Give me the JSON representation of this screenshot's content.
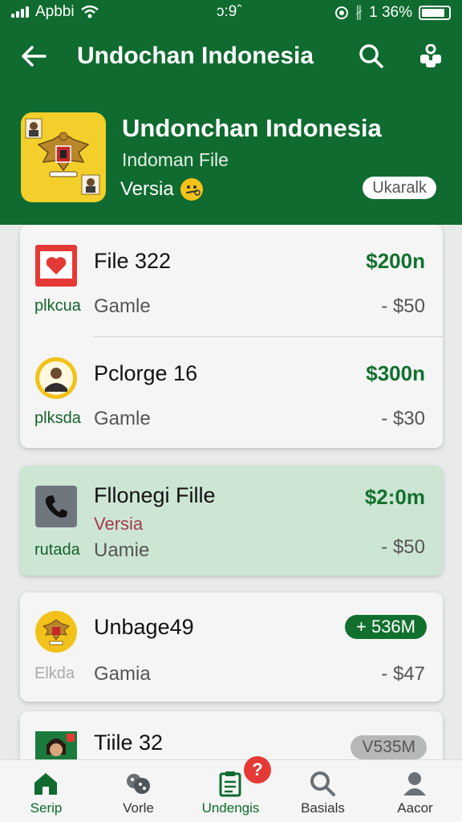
{
  "status_bar": {
    "carrier": "Apbbi",
    "time": "ɔ:9ˆ",
    "bluetooth": "∦",
    "battery_text": "1 36%"
  },
  "toolbar": {
    "title": "Undochan Indonesia",
    "back_icon": "arrow-left-icon",
    "search_icon": "search-icon",
    "menu_icon": "apps-icon"
  },
  "app_info": {
    "name": "Undonchan Indonesia",
    "subtitle": "Indoman File",
    "version_label": "Versia",
    "action_label": "Ukaralk"
  },
  "list_card_1": [
    {
      "name": "File 322",
      "price": "$200n",
      "tag": "plkcua",
      "type": "Gamle",
      "sub_price": "-  $50",
      "icon": "heart-image-icon"
    },
    {
      "name": "Pclorge 16",
      "price": "$300n",
      "tag": "plksda",
      "type": "Gamle",
      "sub_price": "-  $30",
      "icon": "person-avatar-icon"
    }
  ],
  "list_card_2": {
    "name": "Fllonegi Fille",
    "price": "$2:0m",
    "version": "Versia",
    "tag": "rutada",
    "type": "Uamie",
    "sub_price": "-  $50",
    "icon": "phone-icon"
  },
  "list_card_3": {
    "name": "Unbage49",
    "badge": "+ 536M",
    "tag": "Elkda",
    "type": "Gamia",
    "sub_price": "-  $47",
    "icon": "emblem-icon"
  },
  "list_card_4": {
    "name": "Tiile 32",
    "badge": "V535M",
    "icon": "portrait-icon"
  },
  "bottom_nav": [
    {
      "label": "Serip",
      "icon": "home-icon"
    },
    {
      "label": "Vorle",
      "icon": "dice-icon"
    },
    {
      "label": "Undengis",
      "icon": "clipboard-icon"
    },
    {
      "label": "Basials",
      "icon": "search-icon"
    },
    {
      "label": "Aacor",
      "icon": "person-icon"
    }
  ],
  "notification": "?",
  "colors": {
    "primary": "#0f6b2f",
    "accent_yellow": "#f2cf2b",
    "alert_red": "#e53935",
    "highlight_row": "#cde6d4"
  }
}
